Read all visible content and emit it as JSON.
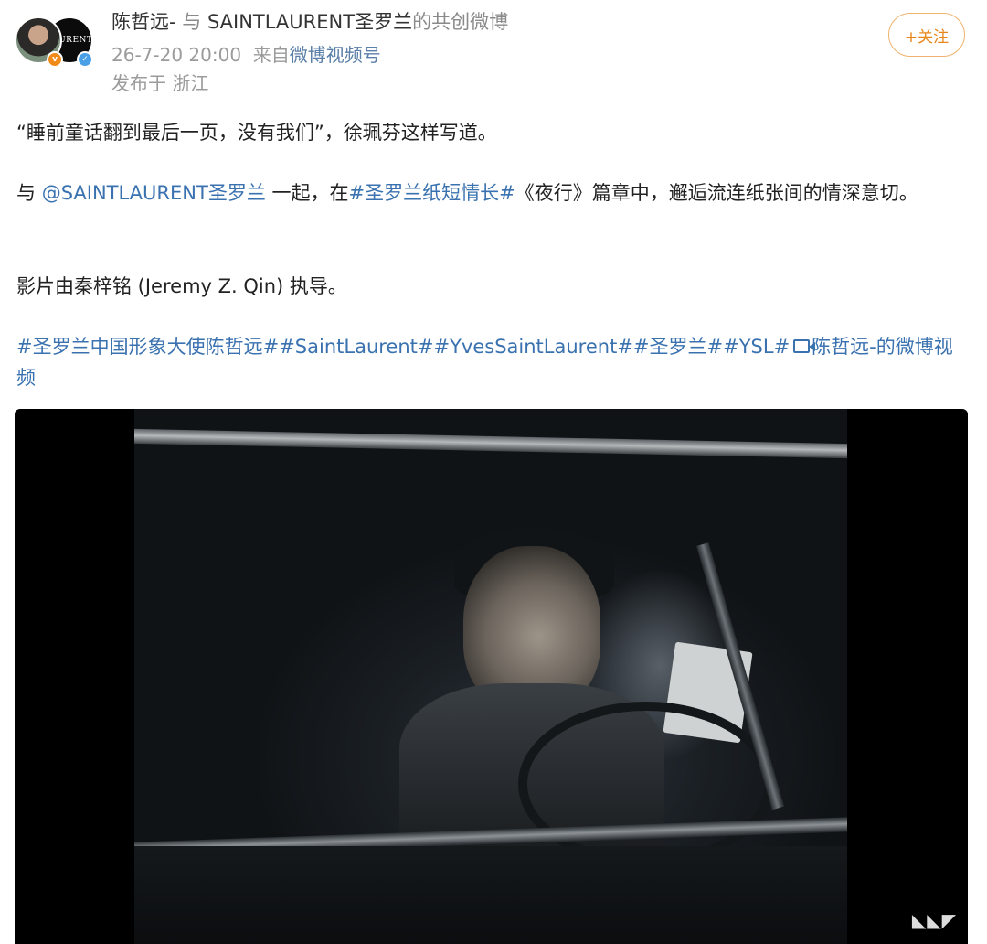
{
  "post": {
    "author": "陈哲远-",
    "co_prefix": " 与 ",
    "co_brand": "SAINTLAURENT",
    "co_brand_cn": "圣罗兰",
    "co_suffix": "的共创微博",
    "timestamp": "26-7-20 20:00",
    "source_prefix": "来自",
    "source": "微博视频号",
    "location": "发布于 浙江",
    "follow_label": "+关注",
    "avatar_brand_text": "LAURENT"
  },
  "content": {
    "p1": "“睡前童话翻到最后一页，没有我们”，徐珮芬这样写道。",
    "p2_prefix": "与 ",
    "p2_mention": "@SAINTLAURENT圣罗兰",
    "p2_mid": " 一起，在",
    "p2_tag": "#圣罗兰纸短情长#",
    "p2_suffix": "《夜行》篇章中，邂逅流连纸张间的情深意切。",
    "p3": "影片由秦梓铭 (Jeremy Z. Qin) 执导。",
    "p4_tag1": "#圣罗兰中国形象大使陈哲远#",
    "p4_tag2": "#SaintLaurent#",
    "p4_tag3": "#YvesSaintLaurent#",
    "p4_tag4": "#圣罗兰#",
    "p4_tag5": "#YSL#",
    "p4_video_link": "陈哲远-的微博视频"
  },
  "colors": {
    "link": "#3a72b0",
    "follow": "#e8861c",
    "meta": "#9b9b9b"
  },
  "icons": {
    "video_link_icon": "video-camera-icon",
    "user_badge": "orange-v-badge",
    "brand_badge": "blue-verified-badge"
  }
}
